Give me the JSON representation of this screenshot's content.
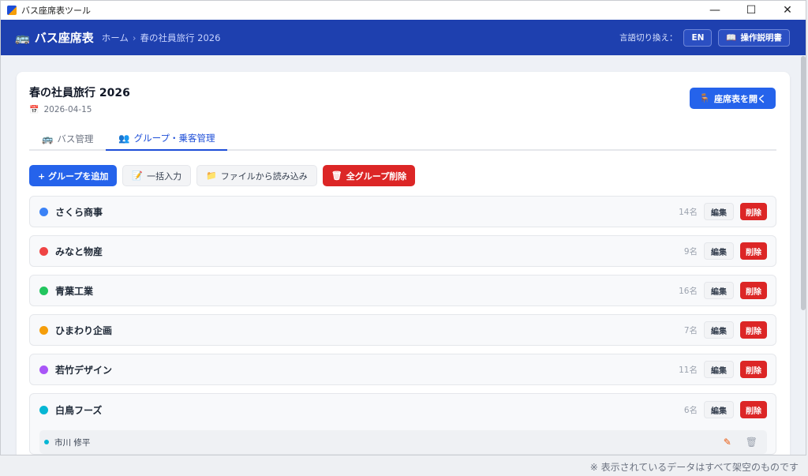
{
  "window": {
    "title": "バス座席表ツール",
    "controls": {
      "minimize": "—",
      "maximize": "☐",
      "close": "✕"
    }
  },
  "header": {
    "app_name": "バス座席表",
    "breadcrumb": [
      "ホーム",
      "春の社員旅行 2026"
    ],
    "breadcrumb_sep": "›",
    "lang_label": "言語切り換え：",
    "lang_button": "EN",
    "manual_button": "操作説明書"
  },
  "trip": {
    "title": "春の社員旅行 2026",
    "date": "2026-04-15",
    "open_seat_button": "座席表を開く"
  },
  "tabs": [
    {
      "label": "バス管理",
      "icon": "🚌"
    },
    {
      "label": "グループ・乗客管理",
      "icon": "👥"
    }
  ],
  "actions": {
    "add_group": "+ グループを追加",
    "bulk_input": "一括入力",
    "load_file": "ファイルから読み込み",
    "delete_all": "全グループ削除"
  },
  "group_buttons": {
    "edit": "編集",
    "delete": "削除"
  },
  "groups": [
    {
      "name": "さくら商事",
      "count": "14名",
      "color": "#3b82f6"
    },
    {
      "name": "みなと物産",
      "count": "9名",
      "color": "#ef4444"
    },
    {
      "name": "青葉工業",
      "count": "16名",
      "color": "#22c55e"
    },
    {
      "name": "ひまわり企画",
      "count": "7名",
      "color": "#f59e0b"
    },
    {
      "name": "若竹デザイン",
      "count": "11名",
      "color": "#a855f7"
    },
    {
      "name": "白鳥フーズ",
      "count": "6名",
      "color": "#06b6d4"
    }
  ],
  "expanded_passengers": [
    {
      "name": "市川 修平"
    }
  ],
  "footer_note": "※ 表示されているデータはすべて架空のものです"
}
